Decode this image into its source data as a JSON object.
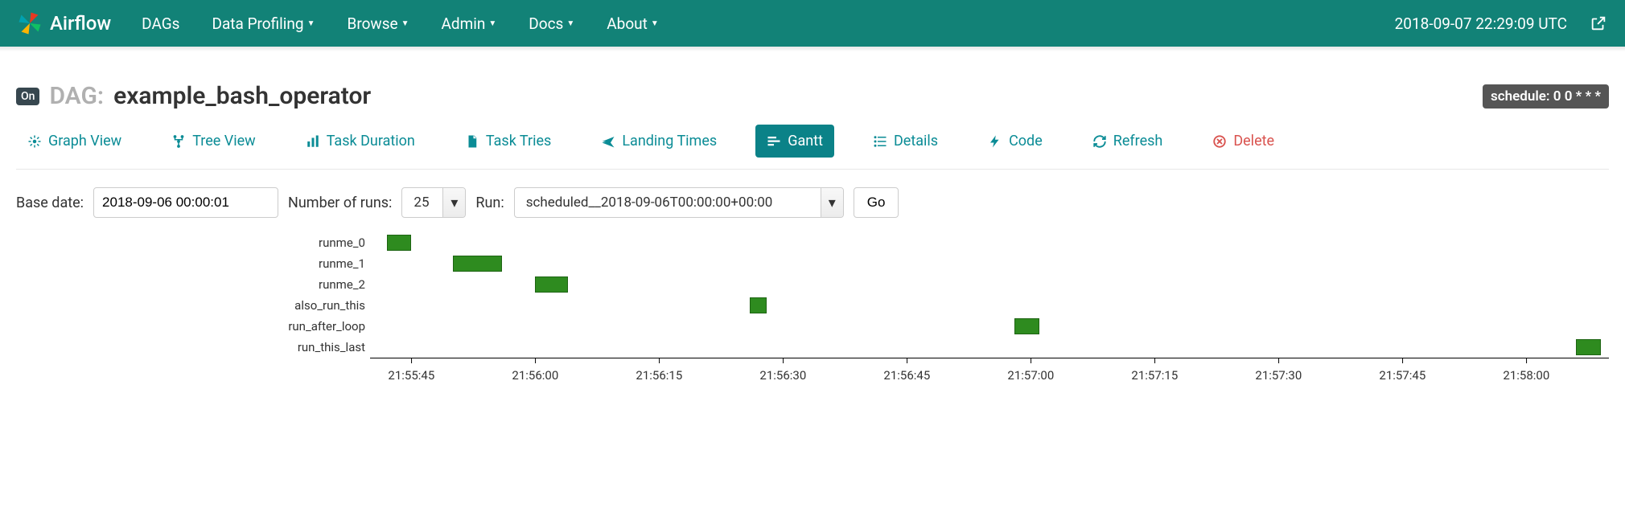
{
  "nav": {
    "brand": "Airflow",
    "items": [
      "DAGs",
      "Data Profiling",
      "Browse",
      "Admin",
      "Docs",
      "About"
    ],
    "items_caret": [
      false,
      true,
      true,
      true,
      true,
      true
    ],
    "clock": "2018-09-07 22:29:09 UTC"
  },
  "header": {
    "on_label": "On",
    "dag_label": "DAG:",
    "dag_id": "example_bash_operator",
    "schedule_prefix": "schedule:",
    "schedule_value": "0 0 * * *"
  },
  "tabs": {
    "graph": "Graph View",
    "tree": "Tree View",
    "duration": "Task Duration",
    "tries": "Task Tries",
    "landing": "Landing Times",
    "gantt": "Gantt",
    "details": "Details",
    "code": "Code",
    "refresh": "Refresh",
    "delete": "Delete"
  },
  "form": {
    "base_date_label": "Base date:",
    "base_date_value": "2018-09-06 00:00:01",
    "num_runs_label": "Number of runs:",
    "num_runs_value": "25",
    "run_label": "Run:",
    "run_value": "scheduled__2018-09-06T00:00:00+00:00",
    "go_label": "Go"
  },
  "chart_data": {
    "type": "bar",
    "x_unit": "time-of-day",
    "x_ticks": [
      "21:55:45",
      "21:56:00",
      "21:56:15",
      "21:56:30",
      "21:56:45",
      "21:57:00",
      "21:57:15",
      "21:57:30",
      "21:57:45",
      "21:58:00"
    ],
    "x_range": [
      "21:55:40",
      "21:58:10"
    ],
    "tasks": [
      {
        "name": "runme_0",
        "start": "21:55:42",
        "end": "21:55:45",
        "color": "#2e8b1f"
      },
      {
        "name": "runme_1",
        "start": "21:55:50",
        "end": "21:55:56",
        "color": "#2e8b1f"
      },
      {
        "name": "runme_2",
        "start": "21:56:00",
        "end": "21:56:04",
        "color": "#2e8b1f"
      },
      {
        "name": "also_run_this",
        "start": "21:56:26",
        "end": "21:56:28",
        "color": "#2e8b1f"
      },
      {
        "name": "run_after_loop",
        "start": "21:56:58",
        "end": "21:57:01",
        "color": "#2e8b1f"
      },
      {
        "name": "run_this_last",
        "start": "21:58:06",
        "end": "21:58:09",
        "color": "#2e8b1f"
      }
    ]
  }
}
